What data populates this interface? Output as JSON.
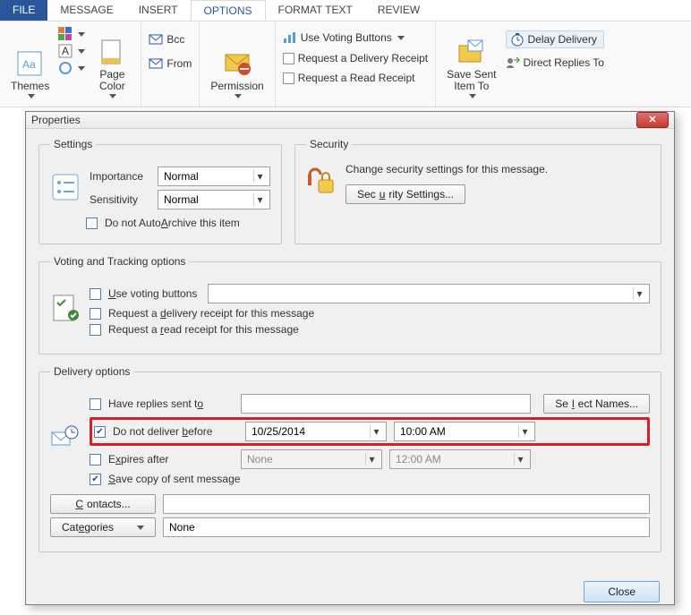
{
  "tabs": {
    "file": "FILE",
    "message": "MESSAGE",
    "insert": "INSERT",
    "options": "OPTIONS",
    "format_text": "FORMAT TEXT",
    "review": "REVIEW"
  },
  "ribbon": {
    "themes": "Themes",
    "page_color": "Page\nColor",
    "bcc": "Bcc",
    "from": "From",
    "permission": "Permission",
    "use_voting": "Use Voting Buttons",
    "delivery_receipt": "Request a Delivery Receipt",
    "read_receipt": "Request a Read Receipt",
    "save_sent": "Save Sent\nItem To",
    "delay_delivery": "Delay Delivery",
    "direct_replies": "Direct Replies To"
  },
  "dialog": {
    "title": "Properties",
    "settings": {
      "legend": "Settings",
      "importance_lbl": "Importance",
      "importance_val": "Normal",
      "sensitivity_lbl": "Sensitivity",
      "sensitivity_val": "Normal",
      "autoarchive": "Do not AutoArchive this item"
    },
    "security": {
      "legend": "Security",
      "desc": "Change security settings for this message.",
      "button": "Security Settings..."
    },
    "voting": {
      "legend": "Voting and Tracking options",
      "use_voting": "Use voting buttons",
      "delivery_receipt": "Request a delivery receipt for this message",
      "read_receipt": "Request a read receipt for this message"
    },
    "delivery": {
      "legend": "Delivery options",
      "have_replies": "Have replies sent to",
      "select_names": "Select Names...",
      "do_not_deliver": "Do not deliver before",
      "date": "10/25/2014",
      "time": "10:00 AM",
      "expires_after": "Expires after",
      "expires_date": "None",
      "expires_time": "12:00 AM",
      "save_copy": "Save copy of sent message",
      "contacts": "Contacts...",
      "categories": "Categories",
      "categories_val": "None"
    },
    "close": "Close"
  }
}
